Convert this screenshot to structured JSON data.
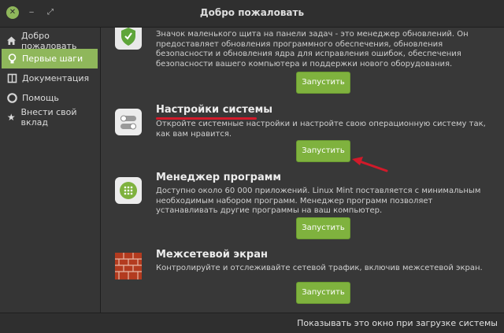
{
  "window": {
    "title": "Добро пожаловать"
  },
  "sidebar": {
    "items": [
      {
        "label": "Добро пожаловать",
        "icon": "home-icon"
      },
      {
        "label": "Первые шаги",
        "icon": "lightbulb-icon",
        "active": true
      },
      {
        "label": "Документация",
        "icon": "book-icon"
      },
      {
        "label": "Помощь",
        "icon": "lifebuoy-icon"
      },
      {
        "label": "Внести свой вклад",
        "icon": "star-icon"
      }
    ]
  },
  "main": {
    "entries": [
      {
        "title": "",
        "icon": "shield-icon",
        "description": "Значок маленького щита на панели задач - это менеджер обновлений. Он предоставляет обновления программного обеспечения, обновления безопасности и обновления ядра для исправления ошибок, обеспечения безопасности вашего компьютера и поддержки нового оборудования.",
        "button": "Запустить"
      },
      {
        "title": "Настройки системы",
        "icon": "settings-toggle-icon",
        "description": "Откройте системные настройки и настройте свою операционную систему так, как вам нравится.",
        "button": "Запустить"
      },
      {
        "title": "Менеджер программ",
        "icon": "software-manager-icon",
        "description": "Доступно около 60 000 приложений. Linux Mint поставляется с минимальным необходимым набором программ. Менеджер программ позволяет устанавливать другие программы на ваш компьютер.",
        "button": "Запустить"
      },
      {
        "title": "Межсетевой экран",
        "icon": "firewall-brick-icon",
        "description": "Контролируйте и отслеживайте сетевой трафик, включив межсетевой экран.",
        "button": "Запустить"
      }
    ]
  },
  "statusbar": {
    "text": "Показывать это окно при загрузке системы"
  },
  "colors": {
    "accent": "#8fb75b",
    "button": "#7fb23e",
    "annotation": "#d11a2a"
  }
}
